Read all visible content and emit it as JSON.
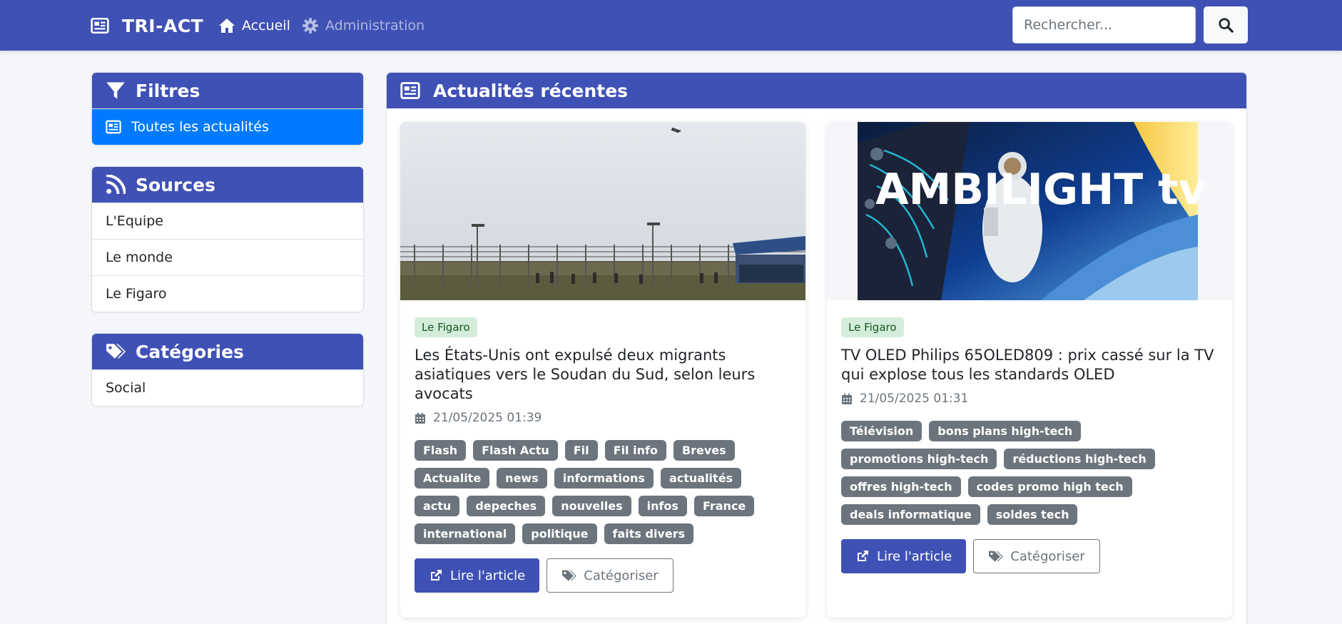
{
  "navbar": {
    "brand": "TRI-ACT",
    "brand_icon": "newspaper-icon",
    "links": [
      {
        "label": "Accueil",
        "icon": "home-icon",
        "active": true
      },
      {
        "label": "Administration",
        "icon": "gear-icon",
        "active": false
      }
    ],
    "search": {
      "placeholder": "Rechercher...",
      "value": "",
      "button_icon": "search-icon"
    }
  },
  "sidebar": {
    "filters": {
      "title": "Filtres",
      "icon": "filter-icon",
      "items": [
        {
          "label": "Toutes les actualités",
          "icon": "newspaper-icon",
          "active": true
        }
      ]
    },
    "sources": {
      "title": "Sources",
      "icon": "rss-icon",
      "items": [
        {
          "label": "L'Equipe"
        },
        {
          "label": "Le monde"
        },
        {
          "label": "Le Figaro"
        }
      ]
    },
    "categories": {
      "title": "Catégories",
      "icon": "tags-icon",
      "items": [
        {
          "label": "Social"
        }
      ]
    }
  },
  "main": {
    "title": "Actualités récentes",
    "icon": "newspaper-icon",
    "articles": [
      {
        "source": "Le Figaro",
        "title": "Les États-Unis ont expulsé deux migrants asiatiques vers le Soudan du Sud, selon leurs avocats",
        "date": "21/05/2025 01:39",
        "tags": [
          "Flash",
          "Flash Actu",
          "Fil",
          "Fil info",
          "Breves",
          "Actualite",
          "news",
          "informations",
          "actualités",
          "actu",
          "depeches",
          "nouvelles",
          "infos",
          "France",
          "international",
          "politique",
          "faits divers"
        ],
        "read_label": "Lire l'article",
        "categorize_label": "Catégoriser"
      },
      {
        "source": "Le Figaro",
        "title": "TV OLED Philips 65OLED809 : prix cassé sur la TV qui explose tous les standards OLED",
        "date": "21/05/2025 01:31",
        "image_text": "AMBILIGHT tv",
        "tags": [
          "Télévision",
          "bons plans high-tech",
          "promotions high-tech",
          "réductions high-tech",
          "offres high-tech",
          "codes promo high tech",
          "deals informatique",
          "soldes tech"
        ],
        "read_label": "Lire l'article",
        "categorize_label": "Catégoriser"
      }
    ]
  },
  "colors": {
    "primary": "#3f51b5",
    "active_blue": "#007bff",
    "tag_gray": "#6c757d",
    "source_badge_bg": "#d4edda",
    "source_badge_text": "#155724",
    "page_bg": "#f5f6f9"
  }
}
